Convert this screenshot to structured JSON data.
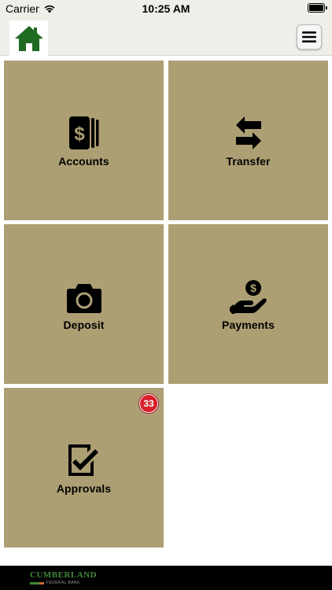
{
  "status_bar": {
    "carrier": "Carrier",
    "time": "10:25 AM"
  },
  "header": {
    "home_icon": "home-icon",
    "menu_icon": "hamburger-menu-icon"
  },
  "tiles": [
    {
      "label": "Accounts",
      "icon": "cash-stack-icon"
    },
    {
      "label": "Transfer",
      "icon": "transfer-arrows-icon"
    },
    {
      "label": "Deposit",
      "icon": "camera-icon"
    },
    {
      "label": "Payments",
      "icon": "hand-dollar-icon"
    },
    {
      "label": "Approvals",
      "icon": "checklist-icon",
      "badge": "33"
    }
  ],
  "footer": {
    "logo_name": "CUMBERLAND",
    "logo_sub": "FEDERAL BANK"
  },
  "colors": {
    "tile": "#ad9f74",
    "header": "#efeee9",
    "home_icon": "#1f6b23",
    "badge": "#d81f2a",
    "footer": "#000000",
    "logo_green": "#3f8a3b"
  }
}
